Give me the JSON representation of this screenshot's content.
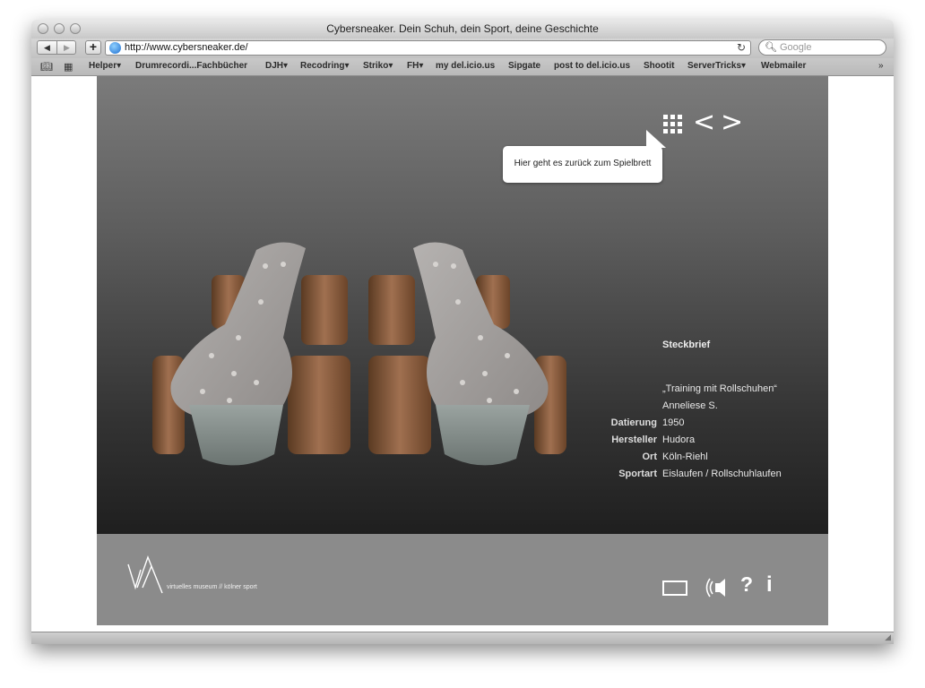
{
  "window": {
    "title": "Cybersneaker. Dein Schuh, dein Sport, deine Geschichte"
  },
  "toolbar": {
    "url": "http://www.cybersneaker.de/",
    "search_placeholder": "Google"
  },
  "bookmarks": [
    "Helper▾",
    "Drumrecordi...Fachbücher",
    "DJH▾",
    "Recodring▾",
    "Striko▾",
    "FH▾",
    "my del.icio.us",
    "Sipgate",
    "post to del.icio.us",
    "Shootit",
    "ServerTricks▾",
    "Webmailer"
  ],
  "tooltip": {
    "text": "Hier geht es zurück zum Spielbrett"
  },
  "navigation": {
    "prev": "<",
    "next": ">"
  },
  "info": {
    "title": "Steckbrief",
    "quote": "„Training mit Rollschuhen“",
    "person": "Anneliese S.",
    "rows": [
      {
        "label": "Datierung",
        "value": "1950"
      },
      {
        "label": "Hersteller",
        "value": "Hudora"
      },
      {
        "label": "Ort",
        "value": "Köln-Riehl"
      },
      {
        "label": "Sportart",
        "value": "Eislaufen / Rollschuhlaufen"
      }
    ]
  },
  "footer": {
    "logo_text": "virtuelles museum // kölner sport",
    "help_label": "?",
    "info_label": "i"
  },
  "icons": {
    "back": "back-icon",
    "forward": "forward-icon",
    "grid": "grid-icon",
    "screen": "screen-icon",
    "sound": "sound-icon"
  }
}
